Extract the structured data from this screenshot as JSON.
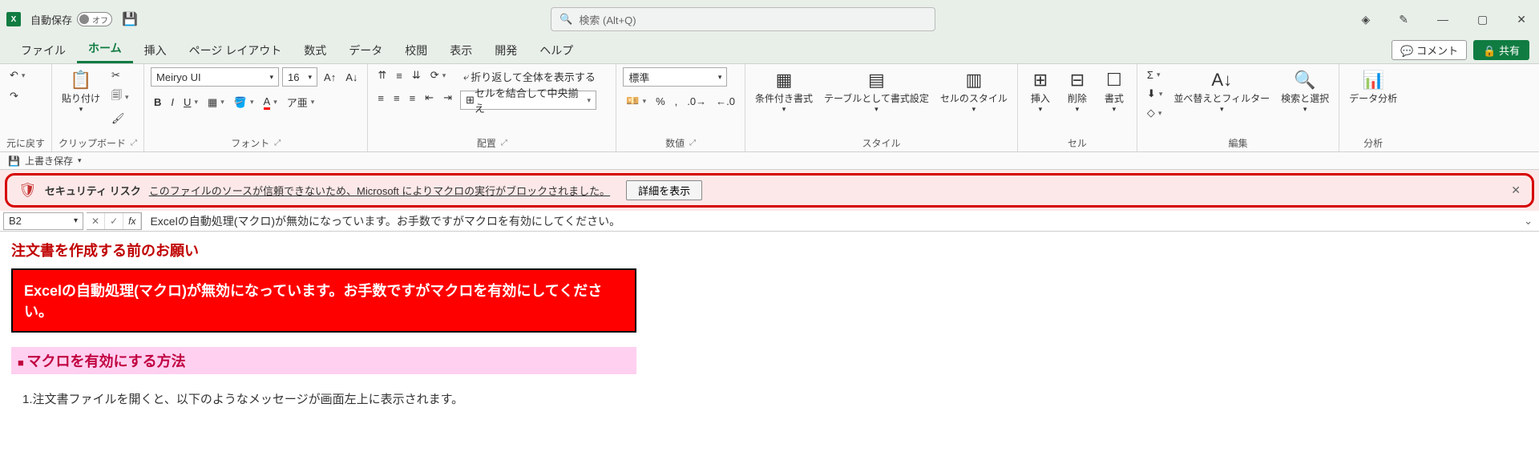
{
  "titlebar": {
    "autosave_label": "自動保存",
    "autosave_state": "オフ",
    "search_placeholder": "検索 (Alt+Q)"
  },
  "tabs": {
    "file": "ファイル",
    "home": "ホーム",
    "insert": "挿入",
    "pagelayout": "ページ レイアウト",
    "formulas": "数式",
    "data": "データ",
    "review": "校閲",
    "view": "表示",
    "developer": "開発",
    "help": "ヘルプ",
    "comment_btn": "コメント",
    "share_btn": "共有"
  },
  "ribbon": {
    "undo_label": "元に戻す",
    "clipboard_label": "クリップボード",
    "paste": "貼り付け",
    "font_label": "フォント",
    "font_name": "Meiryo UI",
    "font_size": "16",
    "ruby": "ア亜",
    "align_label": "配置",
    "wrap": "折り返して全体を表示する",
    "merge": "セルを結合して中央揃え",
    "number_label": "数値",
    "number_format": "標準",
    "styles_label": "スタイル",
    "cond_fmt": "条件付き書式",
    "table_fmt": "テーブルとして書式設定",
    "cell_style": "セルのスタイル",
    "cells_label": "セル",
    "insert_cell": "挿入",
    "delete_cell": "削除",
    "format_cell": "書式",
    "editing_label": "編集",
    "sort_filter": "並べ替えとフィルター",
    "find_select": "検索と選択",
    "analysis_label": "分析",
    "analysis": "データ分析"
  },
  "qat": {
    "save": "上書き保存"
  },
  "security": {
    "title": "セキュリティ リスク",
    "message": "このファイルのソースが信頼できないため、Microsoft によりマクロの実行がブロックされました。",
    "detail_btn": "詳細を表示"
  },
  "fxbar": {
    "cell_ref": "B2",
    "formula": "Excelの自動処理(マクロ)が無効になっています。お手数ですがマクロを有効にしてください。"
  },
  "sheet": {
    "heading": "注文書を作成する前のお願い",
    "red_message": "Excelの自動処理(マクロ)が無効になっています。お手数ですがマクロを有効にしてください。",
    "howto_title": "マクロを有効にする方法",
    "step1": "1.注文書ファイルを開くと、以下のようなメッセージが画面左上に表示されます。"
  }
}
